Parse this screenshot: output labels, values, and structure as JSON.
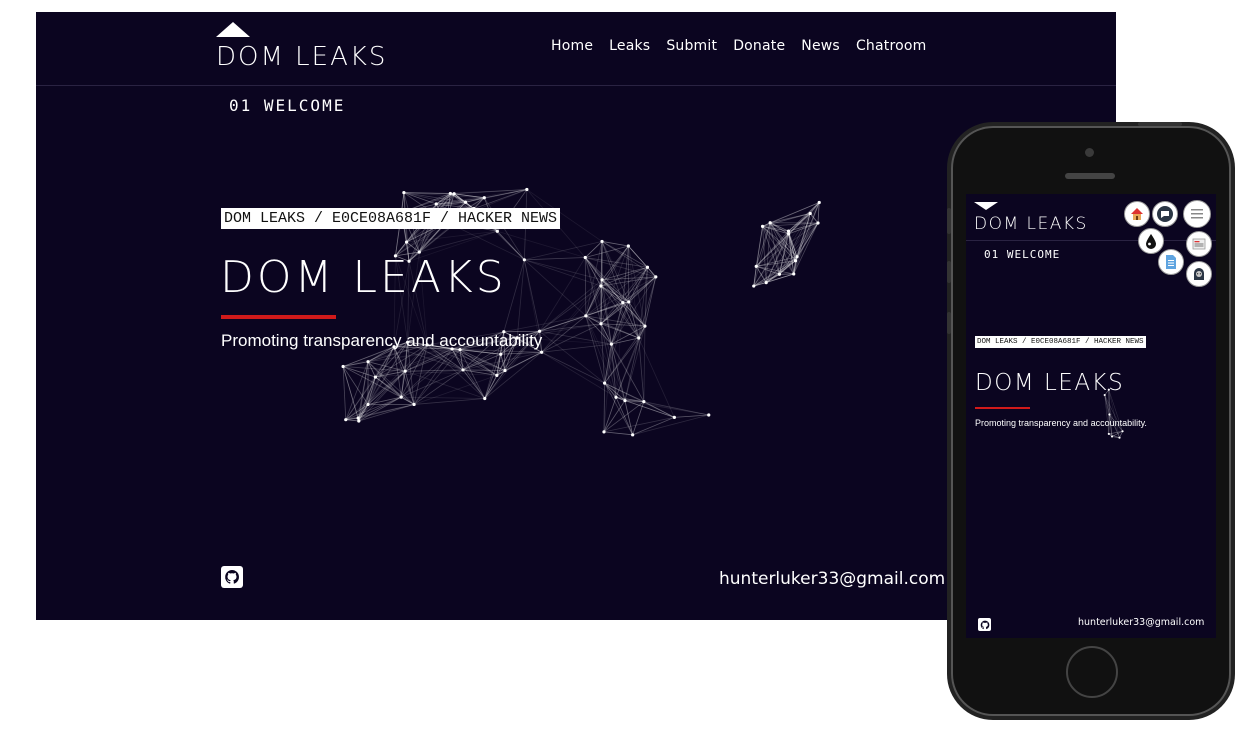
{
  "site": {
    "logo_text": "DOM LEAKS",
    "nav": [
      "Home",
      "Leaks",
      "Submit",
      "Donate",
      "News",
      "Chatroom"
    ],
    "section_label": "01 WELCOME",
    "breadcrumb": "DOM LEAKS / E0CE08A681F / HACKER NEWS",
    "hero_title": "DOM LEAKS",
    "tagline": "Promoting transparency and accountability",
    "email": "hunterluker33@gmail.com"
  },
  "mobile": {
    "logo_text": "DOM LEAKS",
    "section_label": "01 WELCOME",
    "breadcrumb": "DOM LEAKS / E0CE08A681F / HACKER NEWS",
    "hero_title": "DOM LEAKS",
    "tagline": "Promoting transparency and accountability.",
    "email": "hunterluker33@gmail.com",
    "menu_icons": [
      "home-icon",
      "chat-icon",
      "hamburger-menu-icon",
      "drop-icon",
      "news-icon",
      "document-icon",
      "hacker-icon"
    ]
  },
  "colors": {
    "background": "#0b0520",
    "accent": "#d11a1a",
    "text": "#ffffff"
  }
}
